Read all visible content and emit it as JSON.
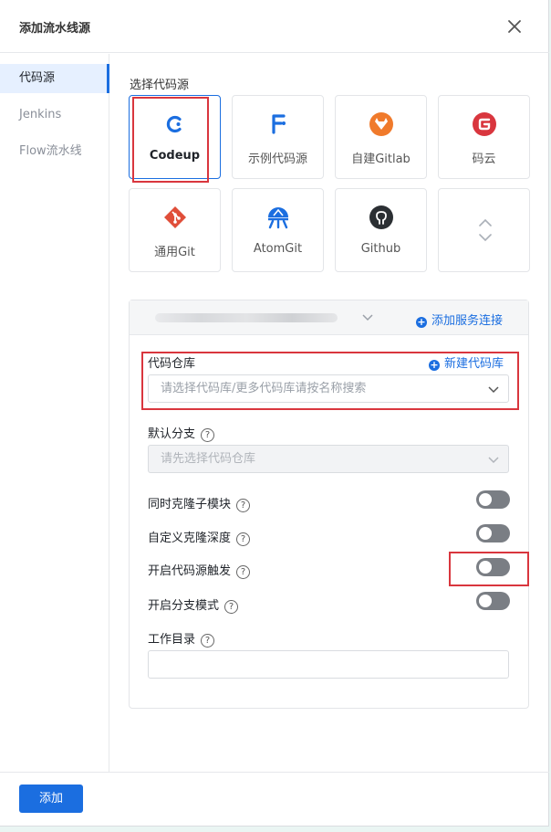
{
  "dialog": {
    "title": "添加流水线源"
  },
  "sidebar": {
    "items": [
      {
        "label": "代码源"
      },
      {
        "label": "Jenkins"
      },
      {
        "label": "Flow流水线"
      }
    ]
  },
  "source": {
    "section_label": "选择代码源",
    "tiles": [
      {
        "label": "Codeup",
        "icon": "codeup-icon"
      },
      {
        "label": "示例代码源",
        "icon": "sample-source-icon"
      },
      {
        "label": "自建Gitlab",
        "icon": "gitlab-icon"
      },
      {
        "label": "码云",
        "icon": "gitee-icon"
      },
      {
        "label": "通用Git",
        "icon": "git-icon"
      },
      {
        "label": "AtomGit",
        "icon": "atomgit-icon"
      },
      {
        "label": "Github",
        "icon": "github-icon"
      }
    ]
  },
  "panel": {
    "add_service_connection": "添加服务连接",
    "repo_label": "代码仓库",
    "new_repo": "新建代码库",
    "repo_placeholder": "请选择代码库/更多代码库请按名称搜索",
    "branch_label": "默认分支",
    "branch_placeholder": "请先选择代码仓库",
    "toggles": [
      {
        "label": "同时克隆子模块",
        "on": false
      },
      {
        "label": "自定义克隆深度",
        "on": false
      },
      {
        "label": "开启代码源触发",
        "on": false
      },
      {
        "label": "开启分支模式",
        "on": false
      }
    ],
    "workdir_label": "工作目录",
    "workdir_value": ""
  },
  "footer": {
    "add_button": "添加"
  },
  "colors": {
    "accent": "#1b6ee0",
    "highlight": "#d9363e",
    "toggle_off": "#7a7e84"
  }
}
